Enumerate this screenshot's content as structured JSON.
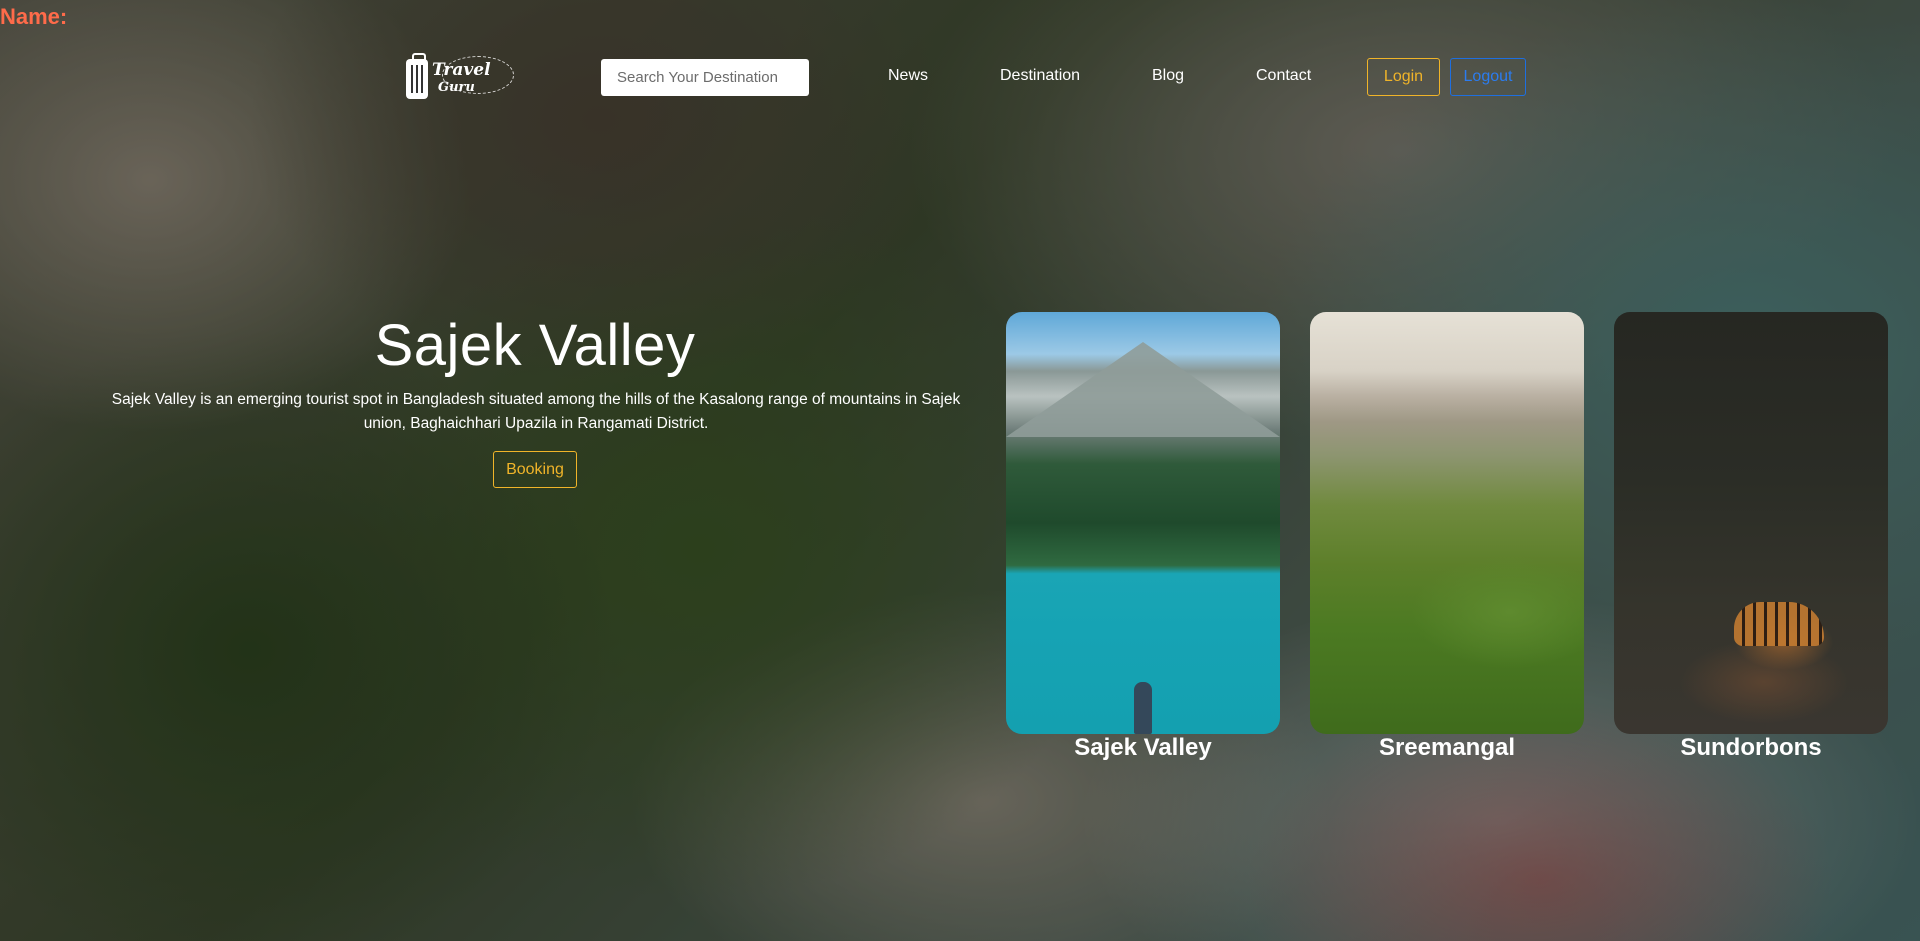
{
  "name_label": "Name:",
  "logo": {
    "line1": "Travel",
    "line2": "Guru"
  },
  "search": {
    "placeholder": "Search Your Destination",
    "value": ""
  },
  "nav": {
    "links": [
      "News",
      "Destination",
      "Blog",
      "Contact"
    ],
    "login_label": "Login",
    "logout_label": "Logout"
  },
  "hero": {
    "title": "Sajek Valley",
    "description": "Sajek Valley is an emerging tourist spot in Bangladesh situated among the hills of the Kasalong range of mountains in Sajek union, Baghaichhari Upazila in Rangamati District.",
    "booking_label": "Booking"
  },
  "cards": [
    {
      "title": "Sajek Valley"
    },
    {
      "title": "Sreemangal"
    },
    {
      "title": "Sundorbons"
    }
  ],
  "colors": {
    "accent_yellow": "#f0b429",
    "accent_blue": "#1e6fe0",
    "name_label": "#ff6b4a"
  }
}
